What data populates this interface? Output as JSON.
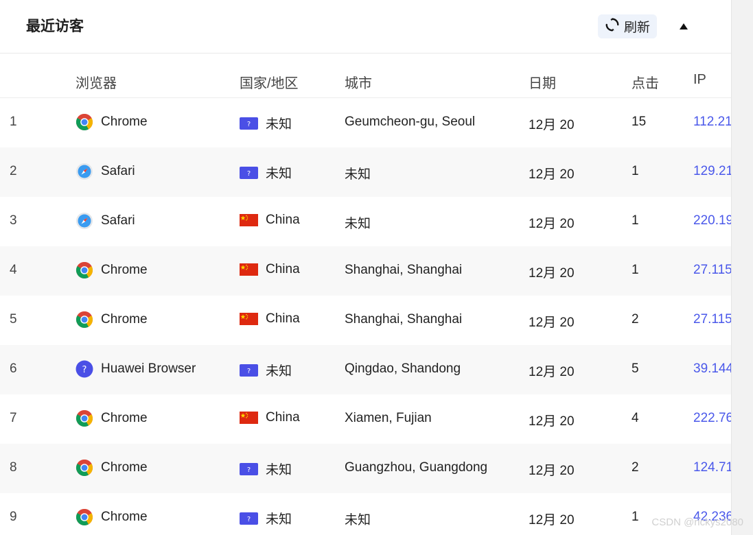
{
  "header": {
    "title": "最近访客",
    "refresh_label": "刷新"
  },
  "columns": [
    "浏览器",
    "国家/地区",
    "城市",
    "日期",
    "点击",
    "IP"
  ],
  "rows": [
    {
      "index": "1",
      "browser": "Chrome",
      "browser_icon": "chrome",
      "country": "未知",
      "flag": "unknown",
      "city": "Geumcheon-gu, Seoul",
      "date": "12月 20",
      "clicks": "15",
      "ip": "112.21"
    },
    {
      "index": "2",
      "browser": "Safari",
      "browser_icon": "safari",
      "country": "未知",
      "flag": "unknown",
      "city": "未知",
      "date": "12月 20",
      "clicks": "1",
      "ip": "129.21"
    },
    {
      "index": "3",
      "browser": "Safari",
      "browser_icon": "safari",
      "country": "China",
      "flag": "cn",
      "city": "未知",
      "date": "12月 20",
      "clicks": "1",
      "ip": "220.19"
    },
    {
      "index": "4",
      "browser": "Chrome",
      "browser_icon": "chrome",
      "country": "China",
      "flag": "cn",
      "city": "Shanghai, Shanghai",
      "date": "12月 20",
      "clicks": "1",
      "ip": "27.115"
    },
    {
      "index": "5",
      "browser": "Chrome",
      "browser_icon": "chrome",
      "country": "China",
      "flag": "cn",
      "city": "Shanghai, Shanghai",
      "date": "12月 20",
      "clicks": "2",
      "ip": "27.115"
    },
    {
      "index": "6",
      "browser": "Huawei Browser",
      "browser_icon": "unknown",
      "country": "未知",
      "flag": "unknown",
      "city": "Qingdao, Shandong",
      "date": "12月 20",
      "clicks": "5",
      "ip": "39.144"
    },
    {
      "index": "7",
      "browser": "Chrome",
      "browser_icon": "chrome",
      "country": "China",
      "flag": "cn",
      "city": "Xiamen, Fujian",
      "date": "12月 20",
      "clicks": "4",
      "ip": "222.76"
    },
    {
      "index": "8",
      "browser": "Chrome",
      "browser_icon": "chrome",
      "country": "未知",
      "flag": "unknown",
      "city": "Guangzhou, Guangdong",
      "date": "12月 20",
      "clicks": "2",
      "ip": "124.71"
    },
    {
      "index": "9",
      "browser": "Chrome",
      "browser_icon": "chrome",
      "country": "未知",
      "flag": "unknown",
      "city": "未知",
      "date": "12月 20",
      "clicks": "1",
      "ip": "42.236"
    }
  ],
  "watermark": "CSDN @rickys2080",
  "colors": {
    "accent": "#4a58ea",
    "flag_unknown": "#4a4fe6",
    "flag_cn": "#de2910"
  }
}
